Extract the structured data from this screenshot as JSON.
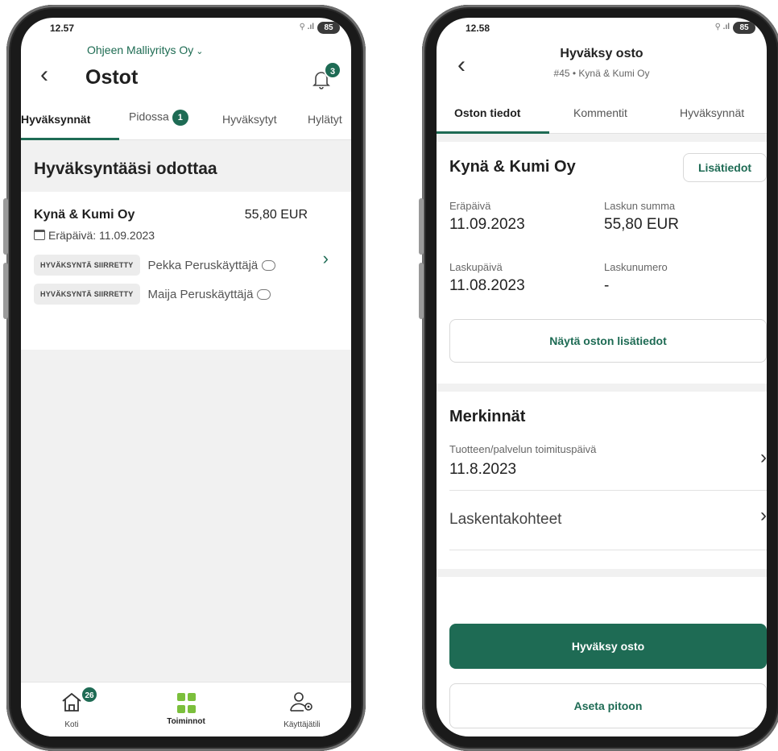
{
  "left": {
    "status": {
      "time": "12.57",
      "signal": "⚲ .ıl",
      "battery": "85"
    },
    "header": {
      "company": "Ohjeen Malliyritys Oy",
      "title": "Ostot",
      "notification_count": "3"
    },
    "tabs": [
      {
        "label": "Hyväksynnät"
      },
      {
        "label": "Pidossa",
        "badge": "1"
      },
      {
        "label": "Hyväksytyt"
      },
      {
        "label": "Hylätyt"
      }
    ],
    "section_title": "Hyväksyntääsi odottaa",
    "purchase": {
      "vendor": "Kynä & Kumi Oy",
      "amount": "55,80 EUR",
      "due": "Eräpäivä: 11.09.2023",
      "approvals": [
        {
          "status": "HYVÄKSYNTÄ SIIRRETTY",
          "name": "Pekka Peruskäyttäjä"
        },
        {
          "status": "HYVÄKSYNTÄ SIIRRETTY",
          "name": "Maija Peruskäyttäjä"
        }
      ]
    },
    "bottom_nav": [
      {
        "label": "Koti",
        "badge": "26"
      },
      {
        "label": "Toiminnot"
      },
      {
        "label": "Käyttäjätili"
      }
    ]
  },
  "right": {
    "status": {
      "time": "12.58",
      "signal": "⚲ .ıl",
      "battery": "85"
    },
    "header": {
      "title": "Hyväksy osto",
      "subtitle": "#45 • Kynä & Kumi Oy"
    },
    "tabs": [
      {
        "label": "Oston tiedot"
      },
      {
        "label": "Kommentit"
      },
      {
        "label": "Hyväksynnät"
      }
    ],
    "info": {
      "vendor": "Kynä & Kumi Oy",
      "more_button": "Lisätiedot",
      "due_label": "Eräpäivä",
      "due_value": "11.09.2023",
      "sum_label": "Laskun summa",
      "sum_value": "55,80 EUR",
      "invoice_date_label": "Laskupäivä",
      "invoice_date_value": "11.08.2023",
      "invoice_number_label": "Laskunumero",
      "invoice_number_value": "-",
      "show_details_button": "Näytä oston lisätiedot"
    },
    "markings": {
      "title": "Merkinnät",
      "delivery_label": "Tuotteen/palvelun toimituspäivä",
      "delivery_value": "11.8.2023",
      "accounting_label": "Laskentakohteet"
    },
    "actions": {
      "approve": "Hyväksy osto",
      "hold": "Aseta pitoon"
    }
  },
  "colors": {
    "brand_green": "#1e6b54",
    "accent_lime": "#7bbf3c",
    "band_gray": "#f1f1f1"
  },
  "icons": [
    "back-chevron-icon",
    "bell-icon",
    "calendar-icon",
    "comment-icon",
    "chevron-right-icon",
    "home-icon",
    "grid-icon",
    "user-settings-icon"
  ]
}
